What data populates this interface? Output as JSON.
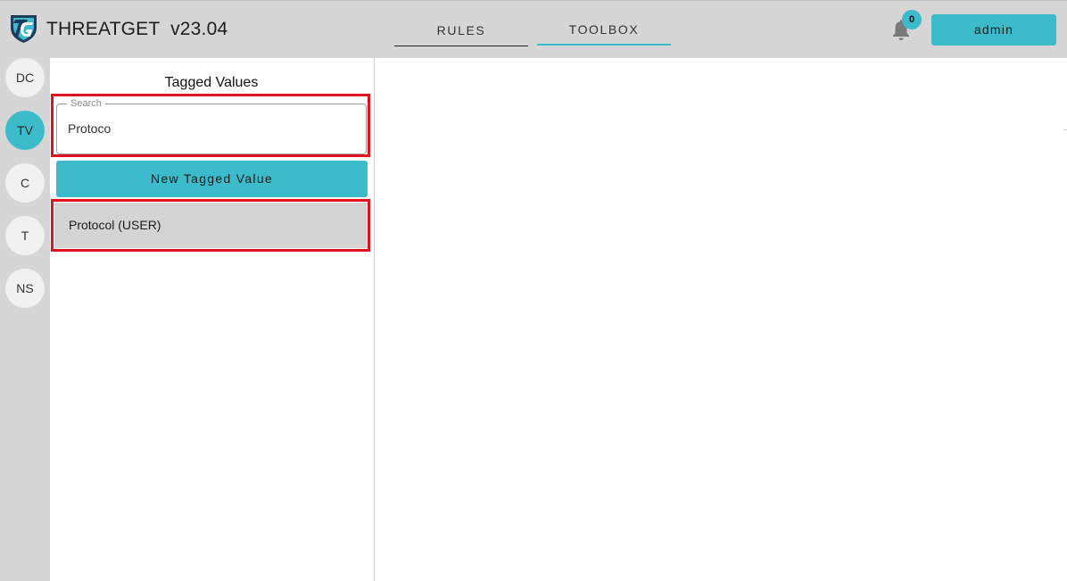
{
  "app": {
    "title": "THREATGET  v23.04",
    "logo_icon": "threatget-shield-logo"
  },
  "nav": {
    "tabs": [
      {
        "label": "RULES",
        "active": false
      },
      {
        "label": "TOOLBOX",
        "active": true
      }
    ]
  },
  "header": {
    "notifications": {
      "icon": "bell-icon",
      "count": "0"
    },
    "user_label": "admin"
  },
  "rail": {
    "items": [
      {
        "label": "DC",
        "active": false
      },
      {
        "label": "TV",
        "active": true
      },
      {
        "label": "C",
        "active": false
      },
      {
        "label": "T",
        "active": false
      },
      {
        "label": "NS",
        "active": false
      }
    ]
  },
  "panel": {
    "title": "Tagged Values",
    "search": {
      "legend": "Search",
      "value": "Protoco"
    },
    "new_button_label": "New Tagged Value",
    "results": [
      {
        "label": "Protocol (USER)"
      }
    ]
  },
  "colors": {
    "accent": "#3cbccb",
    "highlight": "#e0141e",
    "chrome": "#d6d6d6"
  }
}
